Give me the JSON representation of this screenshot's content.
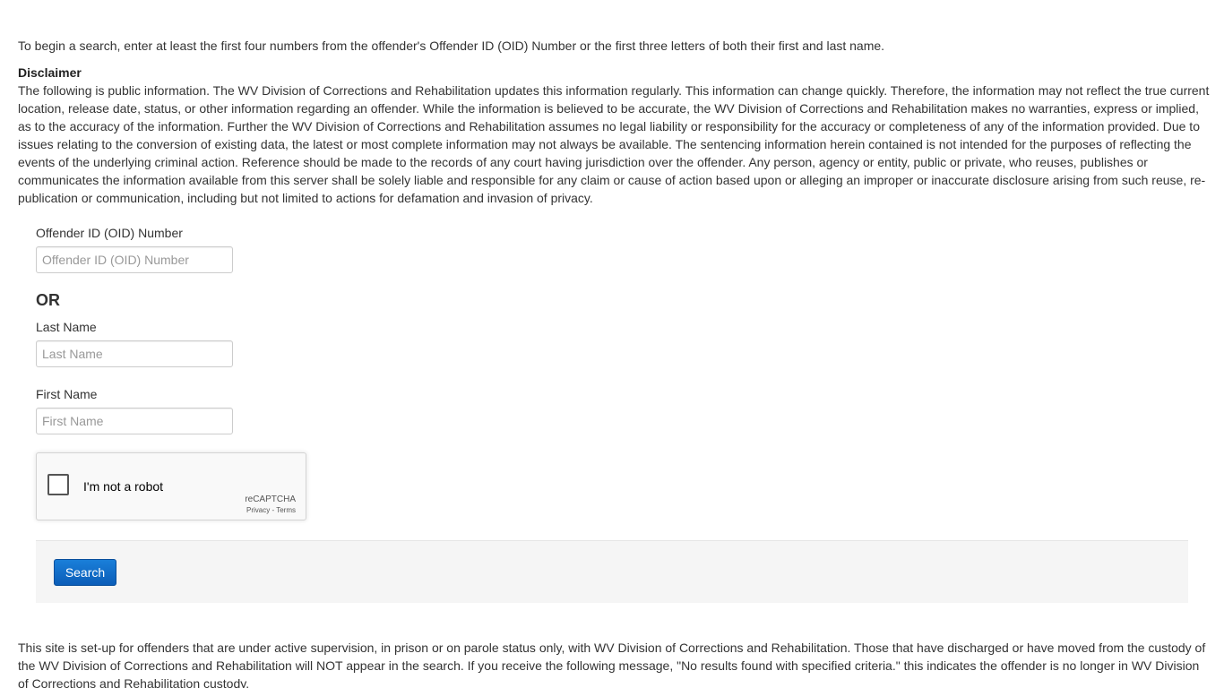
{
  "intro": "To begin a search, enter at least the first four numbers from the offender's Offender ID (OID) Number or the first three letters of both their first and last name.",
  "disclaimer": {
    "title": "Disclaimer",
    "body": "The following is public information. The WV Division of Corrections and Rehabilitation updates this information regularly. This information can change quickly. Therefore, the information may not reflect the true current location, release date, status, or other information regarding an offender. While the information is believed to be accurate, the WV Division of Corrections and Rehabilitation makes no warranties, express or implied, as to the accuracy of the information. Further the WV Division of Corrections and Rehabilitation assumes no legal liability or responsibility for the accuracy or completeness of any of the information provided. Due to issues relating to the conversion of existing data, the latest or most complete information may not always be available. The sentencing information herein contained is not intended for the purposes of reflecting the events of the underlying criminal action. Reference should be made to the records of any court having jurisdiction over the offender. Any person, agency or entity, public or private, who reuses, publishes or communicates the information available from this server shall be solely liable and responsible for any claim or cause of action based upon or alleging an improper or inaccurate disclosure arising from such reuse, re-publication or communication, including but not limited to actions for defamation and invasion of privacy."
  },
  "form": {
    "oid": {
      "label": "Offender ID (OID) Number",
      "placeholder": "Offender ID (OID) Number",
      "value": ""
    },
    "or_label": "OR",
    "last_name": {
      "label": "Last Name",
      "placeholder": "Last Name",
      "value": ""
    },
    "first_name": {
      "label": "First Name",
      "placeholder": "First Name",
      "value": ""
    },
    "recaptcha": {
      "label": "I'm not a robot",
      "brand": "reCAPTCHA",
      "privacy": "Privacy",
      "separator": " - ",
      "terms": "Terms",
      "checked": false
    },
    "search_button": "Search"
  },
  "footer_note": "This site is set-up for offenders that are under active supervision, in prison or on parole status only, with WV Division of Corrections and Rehabilitation. Those that have discharged or have moved from the custody of the WV Division of Corrections and Rehabilitation will NOT appear in the search. If you receive the following message, \"No results found with specified criteria.\" this indicates the offender is no longer in WV Division of Corrections and Rehabilitation custody.",
  "colors": {
    "button": "#0b5db8",
    "action_bar": "#f5f5f5",
    "text": "#333333"
  }
}
